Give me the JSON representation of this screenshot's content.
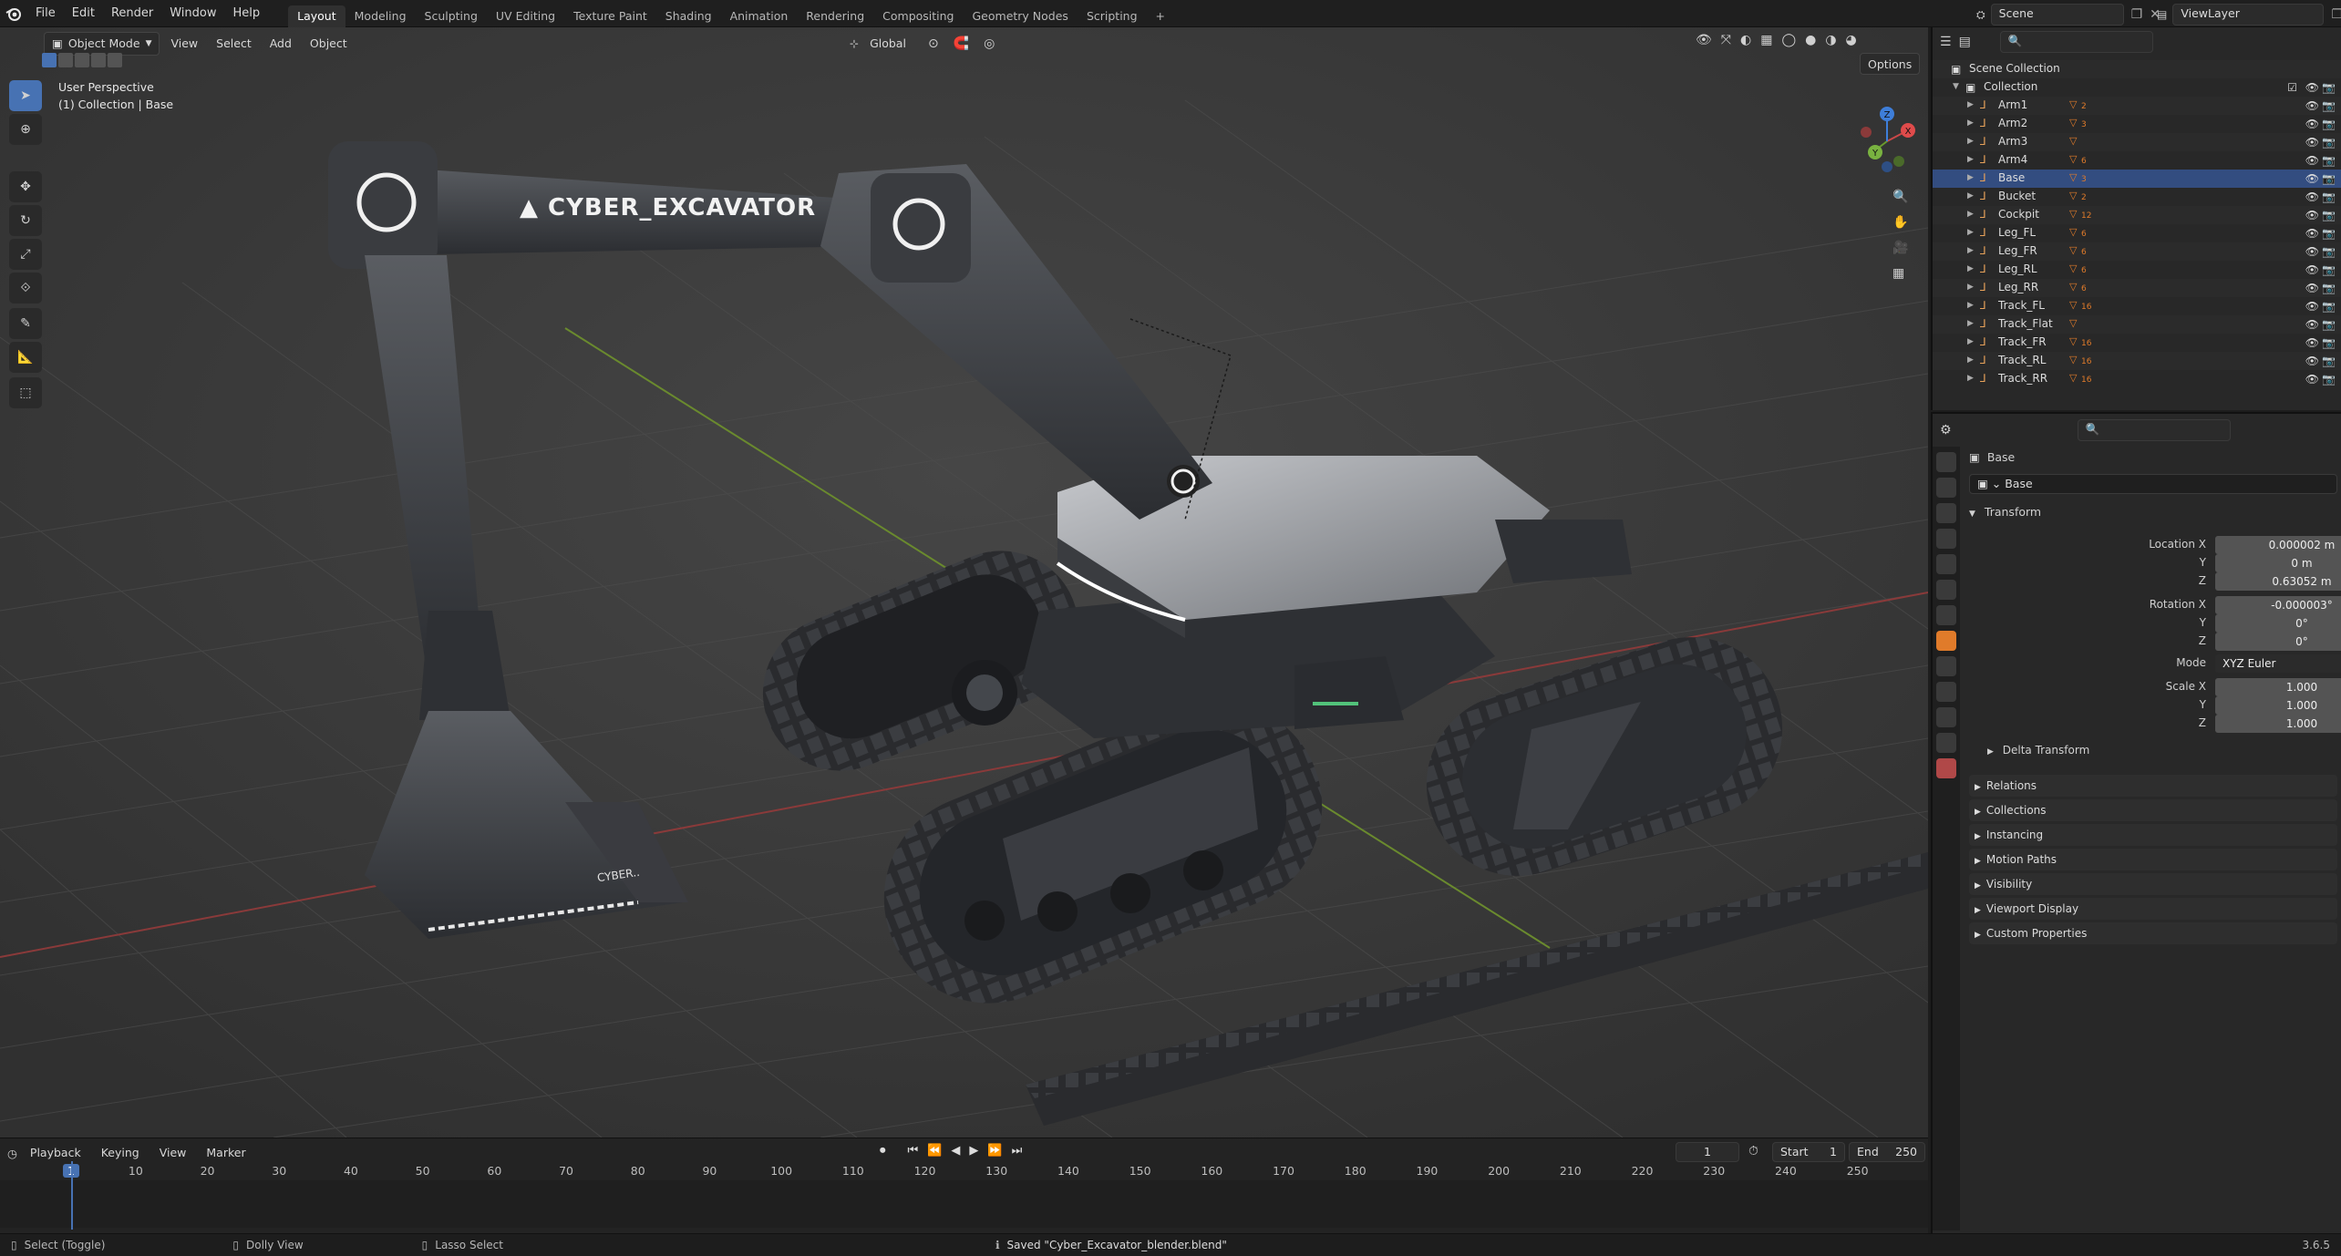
{
  "topbar": {
    "menus": [
      "File",
      "Edit",
      "Render",
      "Window",
      "Help"
    ],
    "workspaces": [
      "Layout",
      "Modeling",
      "Sculpting",
      "UV Editing",
      "Texture Paint",
      "Shading",
      "Animation",
      "Rendering",
      "Compositing",
      "Geometry Nodes",
      "Scripting"
    ],
    "active_workspace": "Layout",
    "add_tab": "+",
    "scene": "Scene",
    "view_layer": "ViewLayer"
  },
  "viewport": {
    "mode": "Object Mode",
    "menus": [
      "View",
      "Select",
      "Add",
      "Object"
    ],
    "transform_orientation": "Global",
    "options": "Options",
    "perspective": "User Perspective",
    "collection_info": "(1) Collection | Base",
    "model_name_decal": "CYBER_EXCAVATOR",
    "bucket_decal": "CYBER..",
    "gizmo_axes": [
      "X",
      "Y",
      "Z"
    ]
  },
  "timeline": {
    "menus": [
      "Playback",
      "Keying",
      "View",
      "Marker"
    ],
    "current_frame": "1",
    "start_label": "Start",
    "start": "1",
    "end_label": "End",
    "end": "250",
    "ticks": [
      "1",
      "10",
      "20",
      "30",
      "40",
      "50",
      "60",
      "70",
      "80",
      "90",
      "100",
      "110",
      "120",
      "130",
      "140",
      "150",
      "160",
      "170",
      "180",
      "190",
      "200",
      "210",
      "220",
      "230",
      "240",
      "250"
    ]
  },
  "statusbar": {
    "hint1": "Select (Toggle)",
    "hint2": "Dolly View",
    "hint3": "Lasso Select",
    "message": "Saved \"Cyber_Excavator_blender.blend\"",
    "version": "3.6.5"
  },
  "outliner": {
    "root": "Scene Collection",
    "collection": "Collection",
    "items": [
      {
        "name": "Arm1",
        "badge": "2"
      },
      {
        "name": "Arm2",
        "badge": "3"
      },
      {
        "name": "Arm3",
        "badge": ""
      },
      {
        "name": "Arm4",
        "badge": "6"
      },
      {
        "name": "Base",
        "badge": "3"
      },
      {
        "name": "Bucket",
        "badge": "2"
      },
      {
        "name": "Cockpit",
        "badge": "12"
      },
      {
        "name": "Leg_FL",
        "badge": "6"
      },
      {
        "name": "Leg_FR",
        "badge": "6"
      },
      {
        "name": "Leg_RL",
        "badge": "6"
      },
      {
        "name": "Leg_RR",
        "badge": "6"
      },
      {
        "name": "Track_FL",
        "badge": "16"
      },
      {
        "name": "Track_Flat",
        "badge": ""
      },
      {
        "name": "Track_FR",
        "badge": "16"
      },
      {
        "name": "Track_RL",
        "badge": "16"
      },
      {
        "name": "Track_RR",
        "badge": "16"
      }
    ]
  },
  "properties": {
    "object": "Base",
    "object_name_field": "Base",
    "transform_label": "Transform",
    "location_label": "Location X",
    "location": [
      "0.000002 m",
      "0 m",
      "0.63052 m"
    ],
    "rotation_label": "Rotation X",
    "rotation": [
      "-0.000003°",
      "0°",
      "0°"
    ],
    "mode_label": "Mode",
    "mode": "XYZ Euler",
    "scale_label": "Scale X",
    "scale": [
      "1.000",
      "1.000",
      "1.000"
    ],
    "axis_y": "Y",
    "axis_z": "Z",
    "delta_transform": "Delta Transform",
    "panels": [
      "Relations",
      "Collections",
      "Instancing",
      "Motion Paths",
      "Visibility",
      "Viewport Display",
      "Custom Properties"
    ]
  }
}
